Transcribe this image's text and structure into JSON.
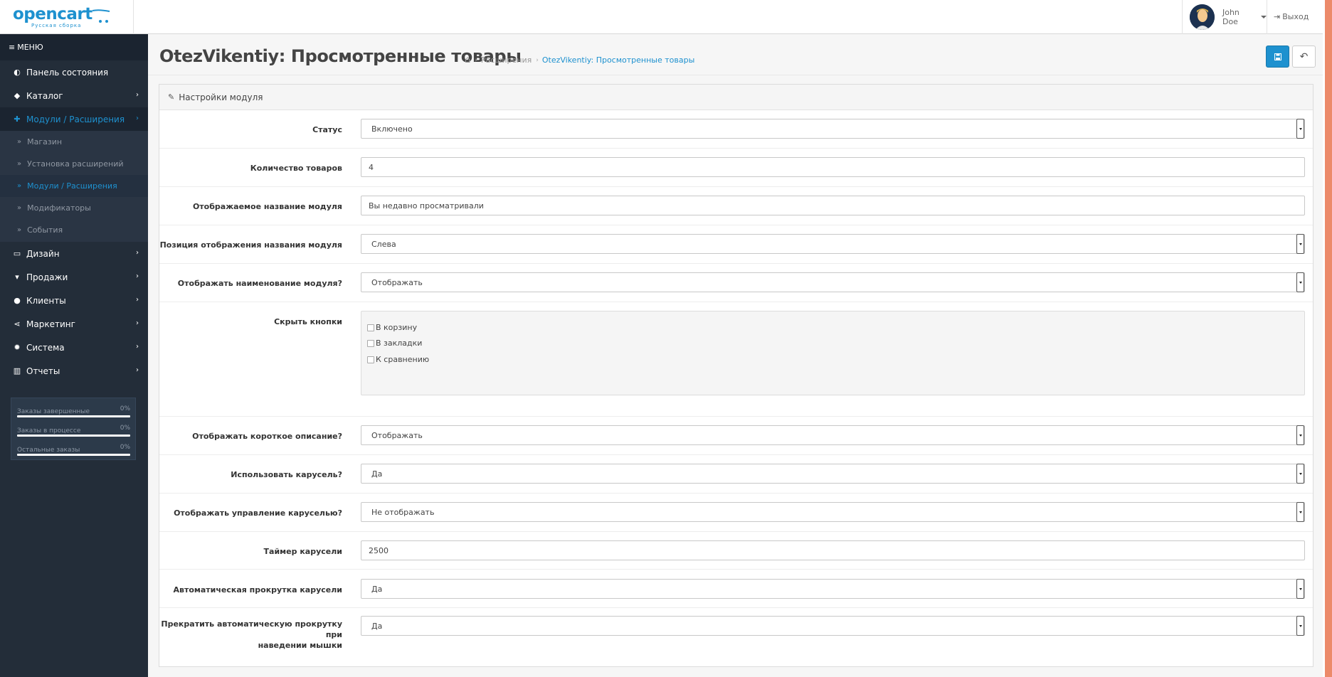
{
  "header": {
    "logo_text": "opencart",
    "logo_subtext": "Русская сборка",
    "user_name": "John Doe",
    "logout_label": "Выход"
  },
  "sidebar": {
    "menu_title": "МЕНЮ",
    "items": [
      {
        "label": "Панель состояния",
        "icon": "dashboard-icon"
      },
      {
        "label": "Каталог",
        "icon": "tags-icon"
      },
      {
        "label": "Модули / Расширения",
        "icon": "puzzle-icon"
      },
      {
        "label": "Дизайн",
        "icon": "monitor-icon"
      },
      {
        "label": "Продажи",
        "icon": "cart-icon"
      },
      {
        "label": "Клиенты",
        "icon": "user-icon"
      },
      {
        "label": "Маркетинг",
        "icon": "share-icon"
      },
      {
        "label": "Система",
        "icon": "gear-icon"
      },
      {
        "label": "Отчеты",
        "icon": "bar-chart-icon"
      }
    ],
    "subitems": [
      {
        "label": "Магазин"
      },
      {
        "label": "Установка расширений"
      },
      {
        "label": "Модули / Расширения"
      },
      {
        "label": "Модификаторы"
      },
      {
        "label": "События"
      }
    ],
    "stats": [
      {
        "label": "Заказы завершенные",
        "percent": "0%"
      },
      {
        "label": "Заказы в процессе",
        "percent": "0%"
      },
      {
        "label": "Остальные заказы",
        "percent": "0%"
      }
    ]
  },
  "page": {
    "title": "OtezVikentiy: Просмотренные товары",
    "breadcrumb": [
      "Расширения",
      "OtezVikentiy: Просмотренные товары"
    ]
  },
  "panel": {
    "heading": "Настройки модуля"
  },
  "form": {
    "status": {
      "label": "Статус",
      "value": "Включено"
    },
    "count": {
      "label": "Количество товаров",
      "value": "4"
    },
    "display_name": {
      "label": "Отображаемое название модуля",
      "value": "Вы недавно просматривали"
    },
    "name_position": {
      "label": "Позиция отображения названия модуля",
      "value": "Слева"
    },
    "show_name": {
      "label": "Отображать наименование модуля?",
      "value": "Отображать"
    },
    "hide_buttons": {
      "label": "Скрыть кнопки",
      "options": [
        "В корзину",
        "В закладки",
        "К сравнению"
      ]
    },
    "short_desc": {
      "label": "Отображать короткое описание?",
      "value": "Отображать"
    },
    "use_carousel": {
      "label": "Использовать карусель?",
      "value": "Да"
    },
    "carousel_controls": {
      "label": "Отображать управление каруселью?",
      "value": "Не отображать"
    },
    "carousel_timer": {
      "label": "Таймер карусели",
      "value": "2500"
    },
    "autoplay": {
      "label": "Автоматическая прокрутка карусели",
      "value": "Да"
    },
    "pause_on_hover": {
      "label_line1": "Прекратить автоматическую прокрутку при",
      "label_line2": "наведении мышки",
      "value": "Да"
    }
  },
  "colors": {
    "accent": "#1e91cf",
    "sidebar_bg": "#232d39",
    "scroll_accent": "#ec8a6a"
  }
}
